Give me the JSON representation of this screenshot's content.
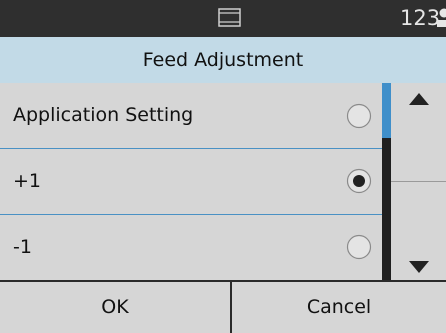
{
  "status_bar": {
    "counter": "123",
    "feeder_icon": "document-feeder-icon",
    "user_icon": "user-icon"
  },
  "title": "Feed Adjustment",
  "options": [
    {
      "label": "Application Setting",
      "selected": false
    },
    {
      "label": "+1",
      "selected": true
    },
    {
      "label": "-1",
      "selected": false
    }
  ],
  "scroll": {
    "up_icon": "arrow-up-icon",
    "down_icon": "arrow-down-icon"
  },
  "buttons": {
    "ok": "OK",
    "cancel": "Cancel"
  },
  "colors": {
    "status_bar": "#2f2f2f",
    "title_bar": "#c2dae7",
    "accent": "#3f8fca",
    "panel": "#d6d6d6"
  }
}
